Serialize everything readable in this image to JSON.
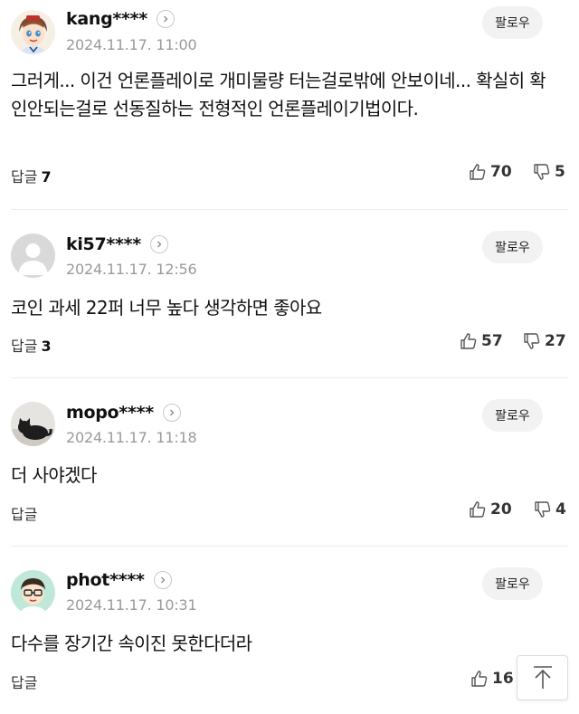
{
  "comments": [
    {
      "nickname": "kang****",
      "date": "2024.11.17. 11:00",
      "follow_label": "팔로우",
      "body": "그러게... 이건 언론플레이로 개미물량 터는걸로밖에 안보이네... 확실히 확인안되는걸로 선동질하는 전형적인 언론플레이기법이다.",
      "reply_label": "답글",
      "reply_count": "7",
      "likes": "70",
      "dislikes": "5",
      "avatar_icon": "cartoon-avatar-icon"
    },
    {
      "nickname": "ki57****",
      "date": "2024.11.17. 12:56",
      "follow_label": "팔로우",
      "body": "코인 과세 22퍼 너무 높다 생각하면 좋아요",
      "reply_label": "답글",
      "reply_count": "3",
      "likes": "57",
      "dislikes": "27",
      "avatar_icon": "default-user-icon"
    },
    {
      "nickname": "mopo****",
      "date": "2024.11.17. 11:18",
      "follow_label": "팔로우",
      "body": "더 사야겠다",
      "reply_label": "답글",
      "reply_count": "",
      "likes": "20",
      "dislikes": "4",
      "avatar_icon": "cat-photo-icon"
    },
    {
      "nickname": "phot****",
      "date": "2024.11.17. 10:31",
      "follow_label": "팔로우",
      "body": "다수를 장기간 속이진 못한다더라",
      "reply_label": "답글",
      "reply_count": "",
      "likes": "16",
      "dislikes": "",
      "avatar_icon": "glasses-avatar-icon"
    }
  ],
  "icons": {
    "like": "thumbs-up-icon",
    "dislike": "thumbs-down-icon",
    "chevron": "chevron-right-icon",
    "scroll_top": "arrow-up-icon"
  },
  "colors": {
    "text": "#111111",
    "muted": "#9a9a9a",
    "follow_bg": "#f2f2f2",
    "divider": "#ececec"
  }
}
